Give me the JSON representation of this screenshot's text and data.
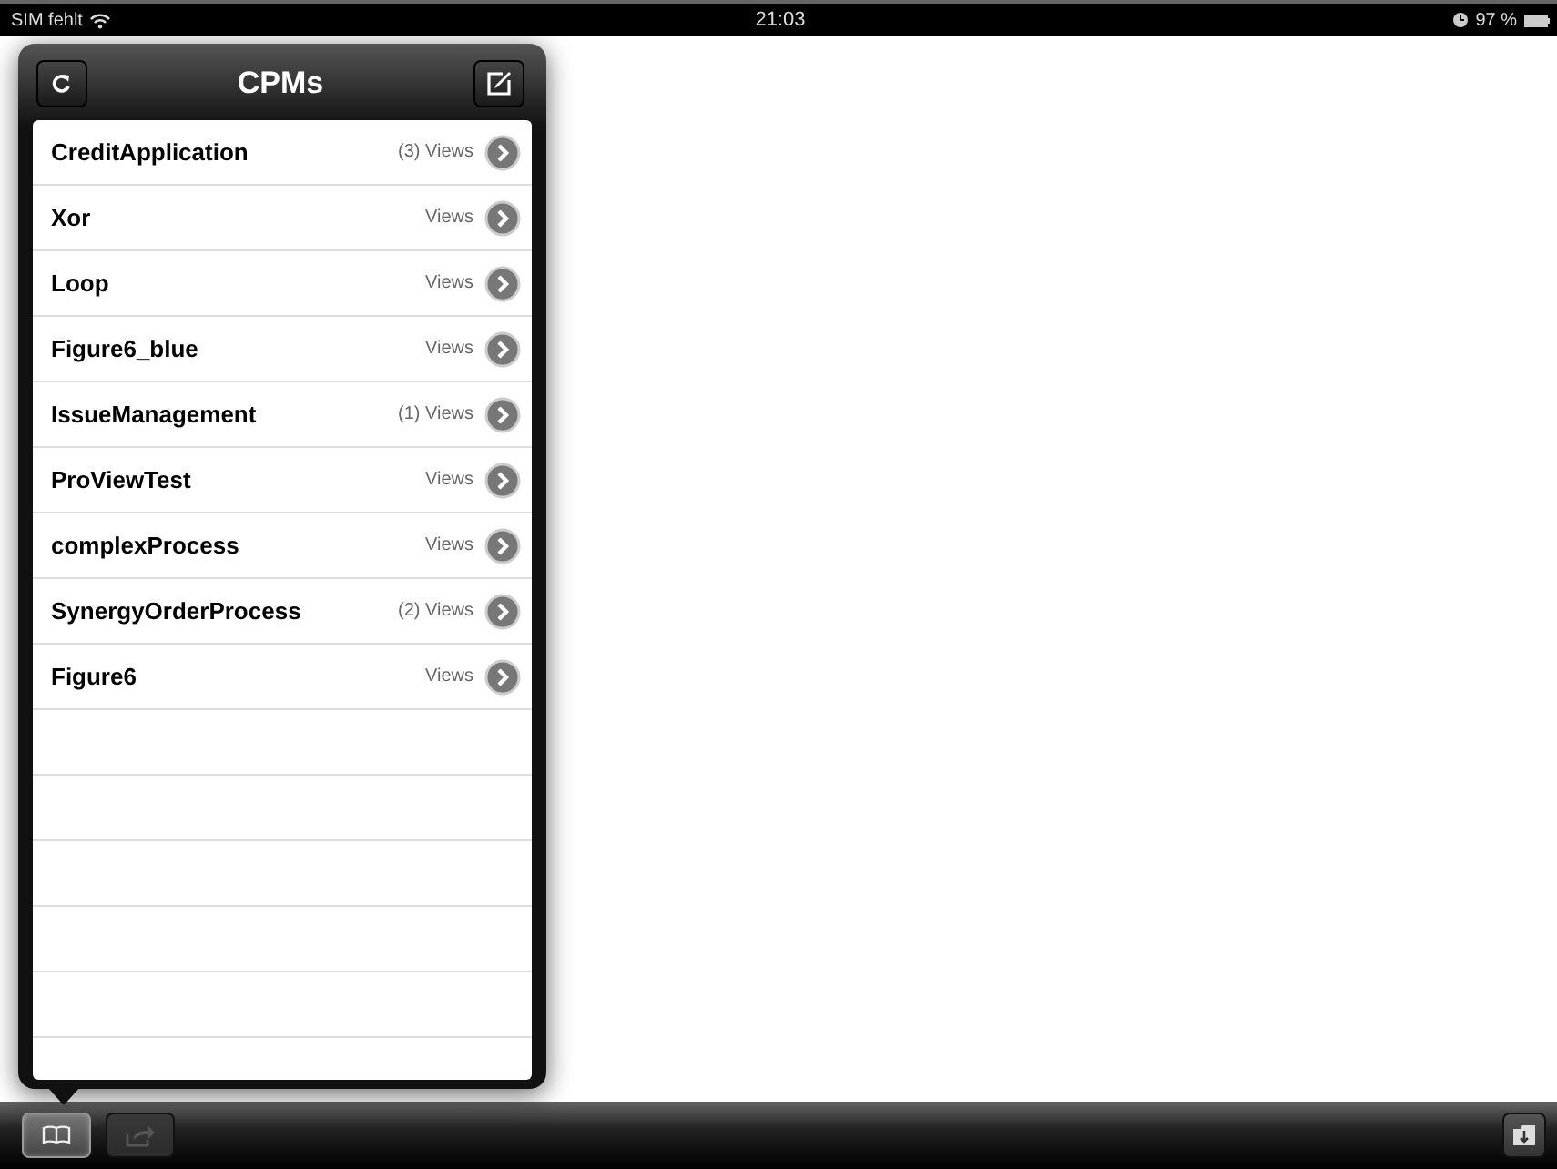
{
  "status_bar": {
    "carrier": "SIM fehlt",
    "time": "21:03",
    "battery": "97 %"
  },
  "popover": {
    "title": "CPMs",
    "items": [
      {
        "name": "CreditApplication",
        "views": "(3) Views"
      },
      {
        "name": "Xor",
        "views": "Views"
      },
      {
        "name": "Loop",
        "views": "Views"
      },
      {
        "name": "Figure6_blue",
        "views": "Views"
      },
      {
        "name": "IssueManagement",
        "views": "(1) Views"
      },
      {
        "name": "ProViewTest",
        "views": "Views"
      },
      {
        "name": "complexProcess",
        "views": "Views"
      },
      {
        "name": "SynergyOrderProcess",
        "views": "(2) Views"
      },
      {
        "name": "Figure6",
        "views": "Views"
      }
    ]
  },
  "toolbar": {
    "buttons": [
      {
        "kind": "book",
        "selected": true,
        "disabled": false
      },
      {
        "kind": "share",
        "selected": false,
        "disabled": true
      }
    ]
  }
}
